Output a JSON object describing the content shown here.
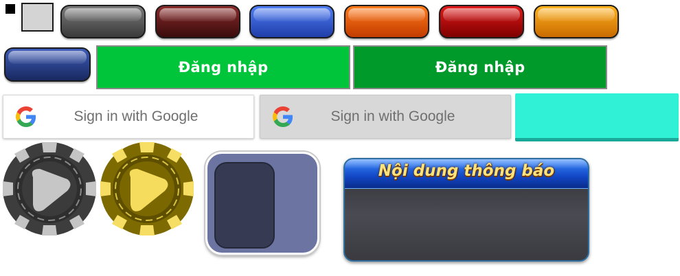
{
  "pill_buttons": [
    {
      "id": "gray",
      "color": "#5a5a5a"
    },
    {
      "id": "dark-red",
      "color": "#5c1414"
    },
    {
      "id": "blue",
      "color": "#2f5ad0"
    },
    {
      "id": "orange",
      "color": "#e65a06"
    },
    {
      "id": "red",
      "color": "#b00000"
    },
    {
      "id": "amber",
      "color": "#e88a10"
    },
    {
      "id": "navy",
      "color": "#26397a"
    }
  ],
  "login": {
    "primary_label": "Đăng nhập",
    "secondary_label": "Đăng nhập",
    "primary_color": "#00c43a",
    "secondary_color": "#009a2a"
  },
  "google": {
    "label_normal": "Sign in with Google",
    "label_pressed": "Sign in with Google",
    "icon": "google-g-icon"
  },
  "teal_button": {
    "color": "#30f0d6"
  },
  "chips": [
    {
      "name": "gray-chip",
      "color": "#b8b8b8"
    },
    {
      "name": "yellow-chip",
      "color": "#f5d95a"
    }
  ],
  "toggle": {
    "track_color": "#6c74a2",
    "knob_color": "#363a52"
  },
  "dialog": {
    "title": "Nội dung thông báo"
  }
}
